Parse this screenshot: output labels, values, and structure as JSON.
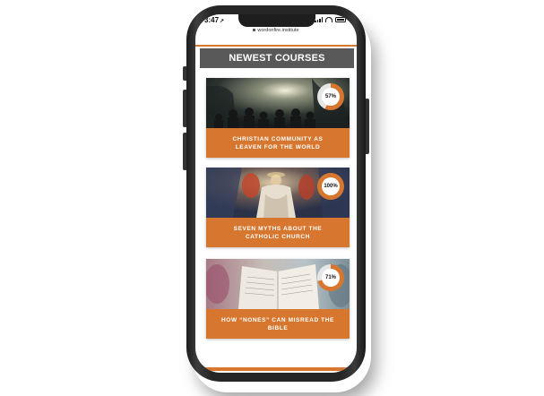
{
  "status_bar": {
    "time": "3:47",
    "location_glyph": "↗"
  },
  "browser": {
    "url": "wordonfire.institute"
  },
  "section": {
    "title": "NEWEST COURSES"
  },
  "courses": [
    {
      "title": "Christian Community as Leaven for the World",
      "progress_label": "57%",
      "progress": 0.57,
      "image": "crowd-in-forest-image"
    },
    {
      "title": "Seven Myths About the Catholic Church",
      "progress_label": "100%",
      "progress": 1.0,
      "image": "religious-painting-image"
    },
    {
      "title": "How “Nones” Can Misread the Bible",
      "progress_label": "71%",
      "progress": 0.71,
      "image": "open-bible-image"
    }
  ],
  "colors": {
    "accent": "#d7772f",
    "header_bg": "#595959",
    "ring_track": "#e6e6e6"
  }
}
